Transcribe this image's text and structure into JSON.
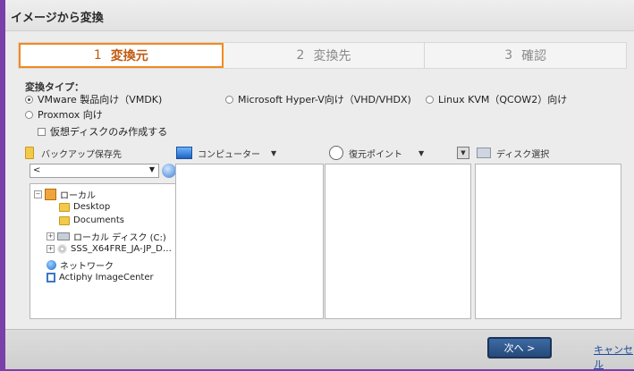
{
  "window": {
    "title": "イメージから変換"
  },
  "steps": [
    {
      "num": "1",
      "label": "変換元",
      "active": true
    },
    {
      "num": "2",
      "label": "変換先",
      "active": false
    },
    {
      "num": "3",
      "label": "確認",
      "active": false
    }
  ],
  "conversion": {
    "type_label": "変換タイプ：",
    "options": [
      {
        "label": "VMware 製品向け（VMDK)",
        "selected": true
      },
      {
        "label": "Microsoft Hyper-V向け（VHD/VHDX)",
        "selected": false
      },
      {
        "label": "Linux KVM（QCOW2）向け",
        "selected": false
      },
      {
        "label": "Proxmox 向け",
        "selected": false
      }
    ],
    "virtual_disk_only": {
      "label": "仮想ディスクのみ作成する",
      "checked": false
    }
  },
  "columns": {
    "backup_location": "バックアップ保存先",
    "computer": "コンピューター",
    "restore_point": "復元ポイント",
    "disk_select": "ディスク選択"
  },
  "location": {
    "value": "<"
  },
  "tree": [
    {
      "label": "ローカル",
      "icon": "home-icon"
    },
    {
      "label": "Desktop",
      "icon": "folder-icon"
    },
    {
      "label": "Documents",
      "icon": "folder-icon"
    },
    {
      "label": "ローカル ディスク (C:)",
      "icon": "drive-icon"
    },
    {
      "label": "SSS_X64FRE_JA-JP_D…",
      "icon": "disc-icon"
    },
    {
      "label": "ネットワーク",
      "icon": "network-icon"
    },
    {
      "label": "Actiphy ImageCenter",
      "icon": "imagecenter-icon"
    }
  ],
  "footer": {
    "next": "次へ >",
    "cancel": "キャンセル"
  },
  "colors": {
    "accent": "#f28a1f",
    "window_border": "#7a3fa8",
    "primary_button": "#2f5b92"
  }
}
